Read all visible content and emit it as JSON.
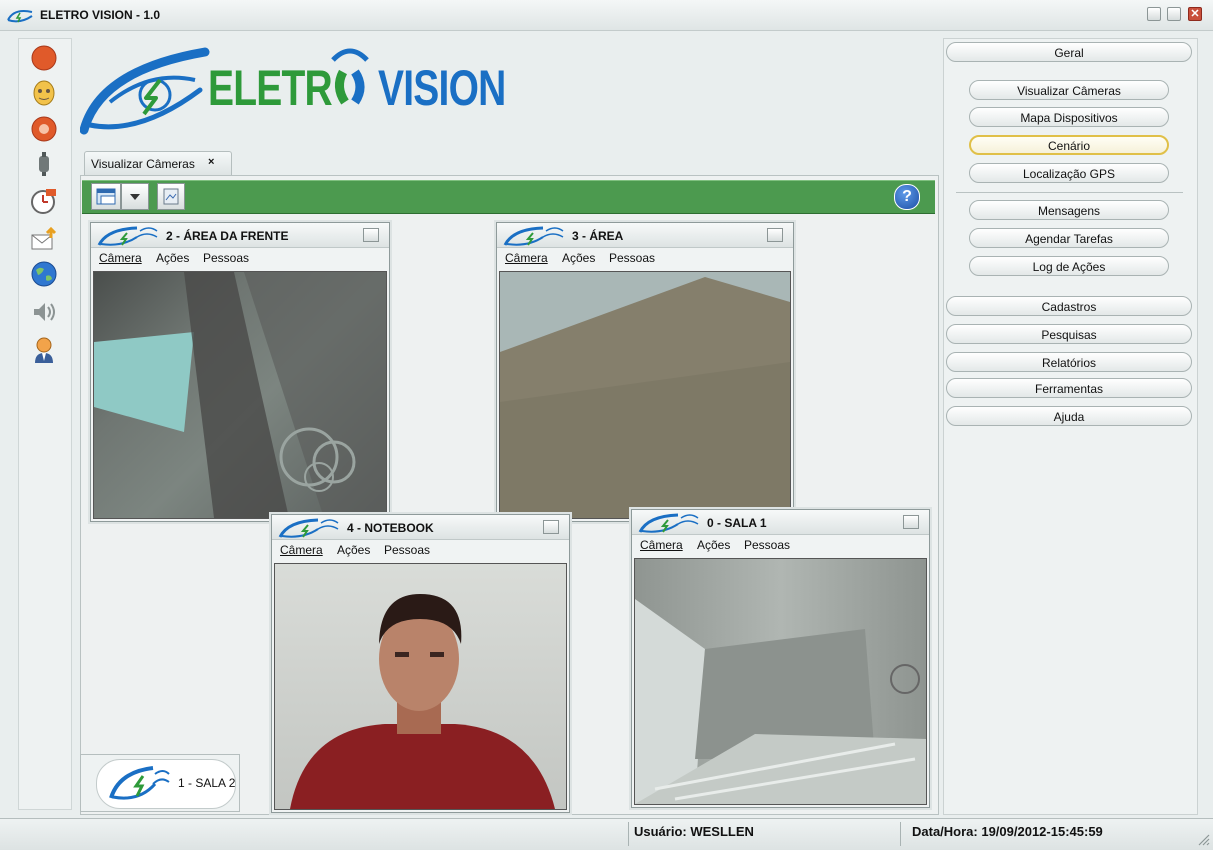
{
  "window": {
    "title": "ELETRO VISION - 1.0",
    "close_glyph": "✕"
  },
  "logo": {
    "text_left": "ELETR",
    "text_right": "VISION"
  },
  "tabs": [
    {
      "label": "Visualizar Câmeras",
      "close_glyph": "×"
    }
  ],
  "toolbar": {
    "help_glyph": "?"
  },
  "cameras": [
    {
      "title": "2 - ÁREA DA FRENTE",
      "menus": [
        "Câmera",
        "Ações",
        "Pessoas"
      ]
    },
    {
      "title": "3 - ÁREA",
      "menus": [
        "Câmera",
        "Ações",
        "Pessoas"
      ]
    },
    {
      "title": "4 - NOTEBOOK",
      "menus": [
        "Câmera",
        "Ações",
        "Pessoas"
      ]
    },
    {
      "title": "0 - SALA 1",
      "menus": [
        "Câmera",
        "Ações",
        "Pessoas"
      ]
    }
  ],
  "minimized_camera": {
    "label": "1 - SALA 2"
  },
  "right_panel": {
    "sections": {
      "geral": "Geral",
      "cadastros": "Cadastros",
      "pesquisas": "Pesquisas",
      "relatorios": "Relatórios",
      "ferramentas": "Ferramentas",
      "ajuda": "Ajuda"
    },
    "items": [
      "Visualizar Câmeras",
      "Mapa Dispositivos",
      "Cenário",
      "Localização GPS",
      "Mensagens",
      "Agendar Tarefas",
      "Log de Ações"
    ]
  },
  "status": {
    "user": "Usuário: WESLLEN",
    "datetime": "Data/Hora: 19/09/2012-15:45:59"
  },
  "colors": {
    "brand_blue": "#1a6fc4",
    "brand_green": "#2e9a3a",
    "toolbar_green": "#4c9a4f",
    "selected_border": "#e0c048"
  }
}
